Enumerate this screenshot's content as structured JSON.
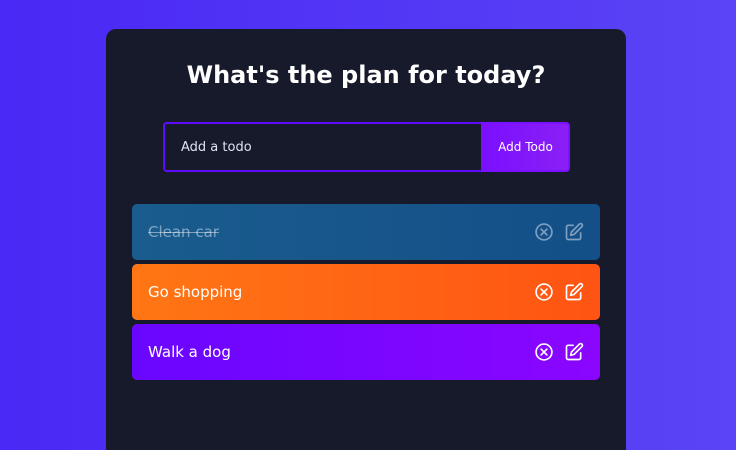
{
  "app": {
    "title": "What's the plan for today?"
  },
  "form": {
    "input_placeholder": "Add a todo",
    "input_value": "",
    "add_button_label": "Add Todo"
  },
  "todos": [
    {
      "text": "Clean car",
      "completed": true,
      "delete_icon": "circle-x-icon",
      "edit_icon": "edit-icon"
    },
    {
      "text": "Go shopping",
      "completed": false,
      "delete_icon": "circle-x-icon",
      "edit_icon": "edit-icon"
    },
    {
      "text": "Walk a dog",
      "completed": false,
      "delete_icon": "circle-x-icon",
      "edit_icon": "edit-icon"
    }
  ],
  "colors": {
    "background": "#4a28f5",
    "panel": "#161a2b",
    "accent": "#5d0cff",
    "row_completed": "#1a5c8e",
    "row_orange": "#ff7614",
    "row_purple": "#7a06ff"
  }
}
